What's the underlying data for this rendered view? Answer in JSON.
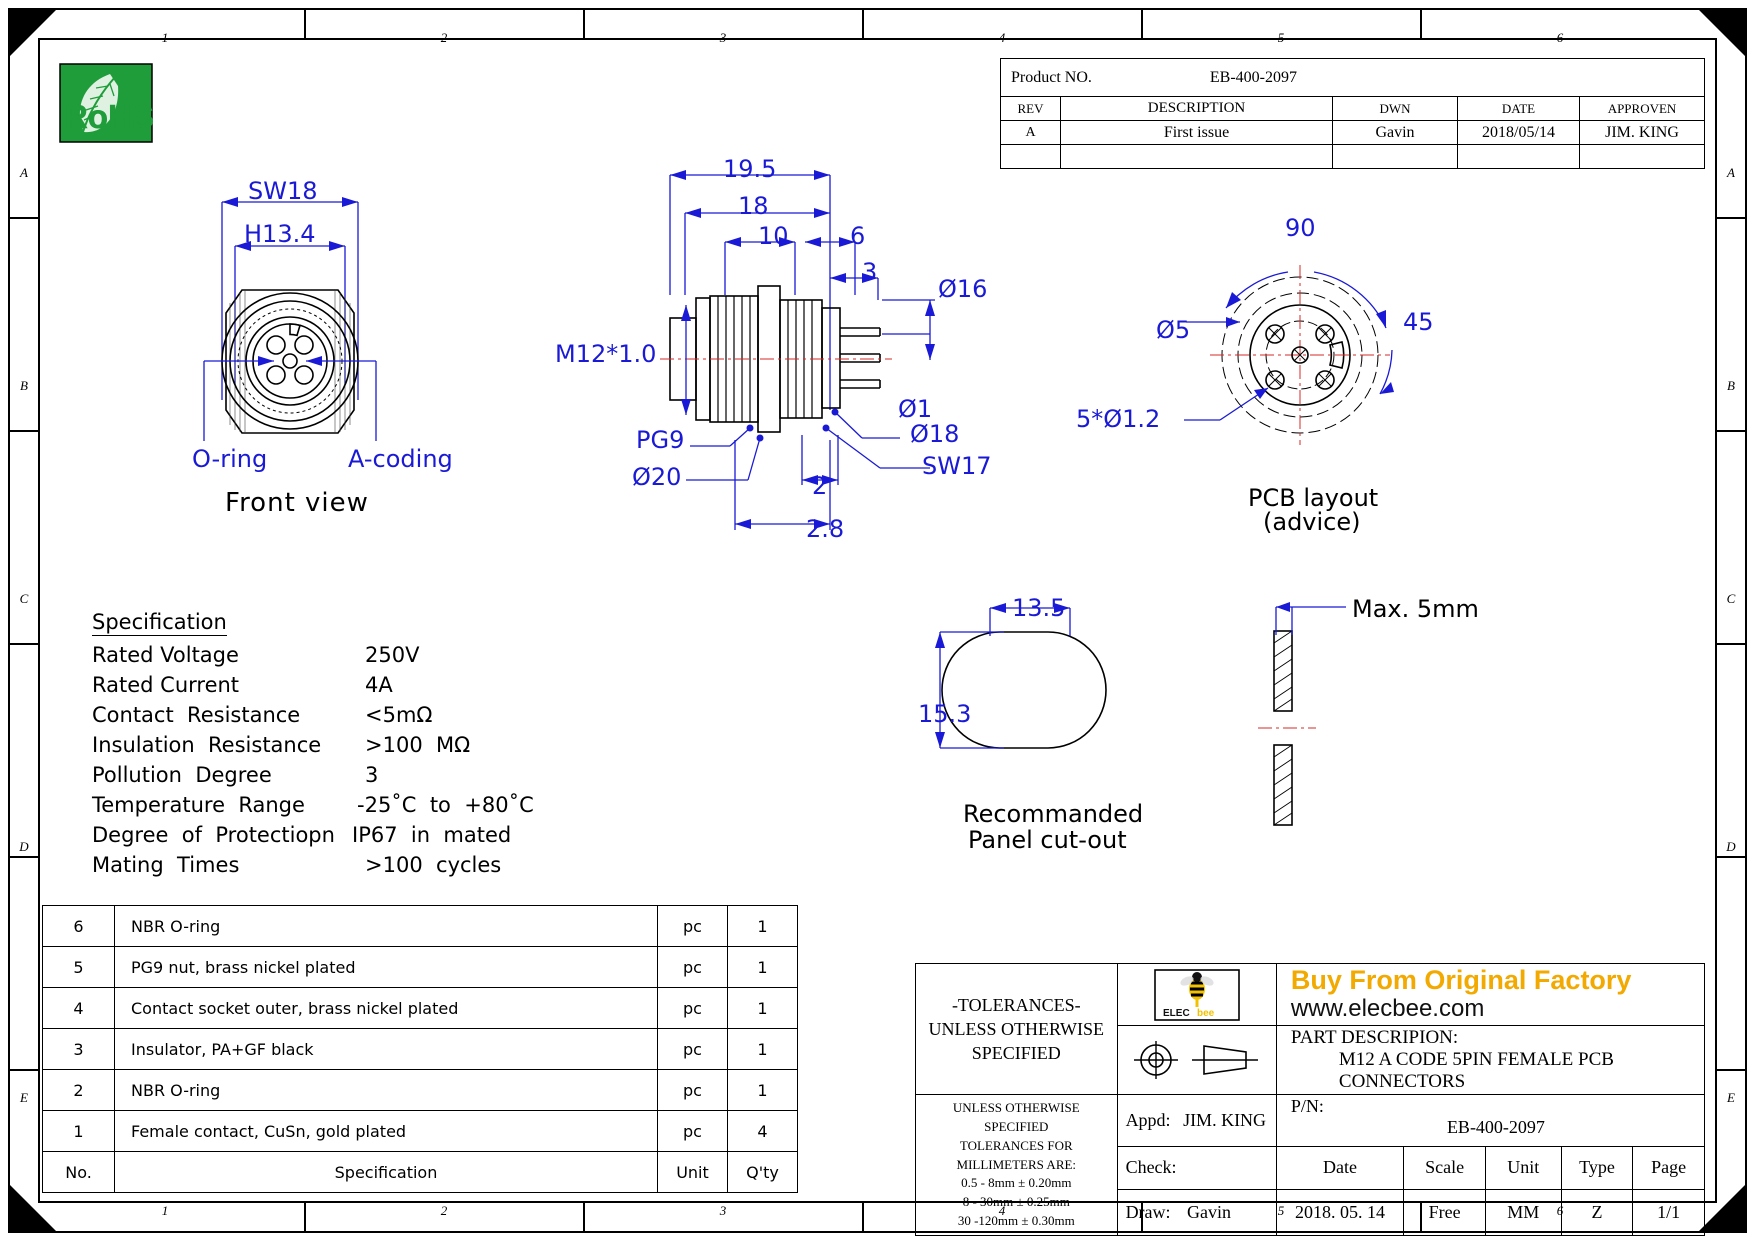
{
  "sheet": {
    "zone_columns": [
      "1",
      "2",
      "3",
      "4",
      "5",
      "6"
    ],
    "zone_rows": [
      "A",
      "B",
      "C",
      "D",
      "E"
    ]
  },
  "rohs_logo": {
    "label": "RoHS"
  },
  "revision_block": {
    "product_no_label": "Product NO.",
    "product_no_value": "EB-400-2097",
    "headers": [
      "REV",
      "DESCRIPTION",
      "DWN",
      "DATE",
      "APPROVEN"
    ],
    "rows": [
      {
        "rev": "A",
        "description": "First issue",
        "dwn": "Gavin",
        "date": "2018/05/14",
        "approven": "JIM. KING"
      },
      {
        "rev": "",
        "description": "",
        "dwn": "",
        "date": "",
        "approven": ""
      }
    ]
  },
  "front_view": {
    "title": "Front view",
    "dim_sw18": "SW18",
    "dim_h134": "H13.4",
    "label_oring": "O-ring",
    "label_acoding": "A-coding"
  },
  "side_view": {
    "dim_19_5": "19.5",
    "dim_18": "18",
    "dim_10": "10",
    "dim_6": "6",
    "dim_3": "3",
    "dim_2": "2",
    "dim_2_8": "2.8",
    "dim_m12": "M12*1.0",
    "label_pg9": "PG9",
    "dim_d20": "Ø20",
    "dim_d16": "Ø16",
    "dim_d1": "Ø1",
    "dim_d18": "Ø18",
    "label_sw17": "SW17"
  },
  "pcb_layout": {
    "title_line1": "PCB layout",
    "title_line2": "(advice)",
    "dim_90": "90",
    "dim_45": "45",
    "dim_d5": "Ø5",
    "dim_5xd12": "5*Ø1.2"
  },
  "panel_cutout": {
    "title_line1": "Recommanded",
    "title_line2": "Panel cut-out",
    "dim_width": "13.5",
    "dim_height": "15.3",
    "dim_thickness": "Max. 5mm"
  },
  "specification": {
    "heading": "Specification",
    "rows": [
      {
        "label": "Rated Voltage",
        "value": "250V"
      },
      {
        "label": "Rated Current",
        "value": "4A"
      },
      {
        "label": "Contact  Resistance",
        "value": "<5mΩ"
      },
      {
        "label": "Insulation  Resistance",
        "value": ">100  MΩ"
      },
      {
        "label": "Pollution  Degree",
        "value": "3"
      },
      {
        "label": "Temperature  Range",
        "value": "-25˚C  to  +80˚C"
      },
      {
        "label": "Degree  of  Protectiopn",
        "value": "IP67  in  mated"
      },
      {
        "label": "Mating  Times",
        "value": ">100  cycles"
      }
    ]
  },
  "bom": {
    "headers": {
      "no": "No.",
      "specification": "Specification",
      "unit": "Unit",
      "qty": "Q'ty"
    },
    "rows": [
      {
        "no": "6",
        "specification": "NBR  O-ring",
        "unit": "pc",
        "qty": "1"
      },
      {
        "no": "5",
        "specification": "PG9  nut,  brass  nickel  plated",
        "unit": "pc",
        "qty": "1"
      },
      {
        "no": "4",
        "specification": "Contact  socket  outer,  brass  nickel  plated",
        "unit": "pc",
        "qty": "1"
      },
      {
        "no": "3",
        "specification": "Insulator,  PA+GF  black",
        "unit": "pc",
        "qty": "1"
      },
      {
        "no": "2",
        "specification": "NBR  O-ring",
        "unit": "pc",
        "qty": "1"
      },
      {
        "no": "1",
        "specification": "Female  contact,  CuSn,  gold  plated",
        "unit": "pc",
        "qty": "4"
      }
    ]
  },
  "title_block": {
    "tolerances_heading_line1": "-TOLERANCES-",
    "tolerances_heading_line2": "UNLESS  OTHERWISE",
    "tolerances_heading_line3": "SPECIFIED",
    "tolerance_note_line1": "UNLESS OTHERWISE SPECIFIED",
    "tolerance_note_line2": "TOLERANCES FOR MILLIMETERS ARE:",
    "tolerance_rows": [
      "0.5 - 8mm ± 0.20mm",
      "8 - 30mm ± 0.25mm",
      "30 -120mm ± 0.30mm"
    ],
    "brand": {
      "logo_text_1": "ELEC",
      "logo_text_2": "bee",
      "tagline": "Buy From Original Factory",
      "website": "www.elecbee.com",
      "tagline_color": "#f2a900"
    },
    "part_description_label": "PART  DESCRIPION:",
    "part_description_value": "M12  A  CODE  5PIN  FEMALE   PCB  CONNECTORS",
    "pn_label": "P/N:",
    "pn_value": "EB-400-2097",
    "appd_label": "Appd:",
    "appd_value": "JIM. KING",
    "check_label": "Check:",
    "check_value": "",
    "draw_label": "Draw:",
    "draw_value": "Gavin",
    "date_label": "Date",
    "date_value": "2018. 05. 14",
    "scale_label": "Scale",
    "scale_value": "Free",
    "unit_label": "Unit",
    "unit_value": "MM",
    "type_label": "Type",
    "type_value": "Z",
    "page_label": "Page",
    "page_value": "1/1"
  }
}
